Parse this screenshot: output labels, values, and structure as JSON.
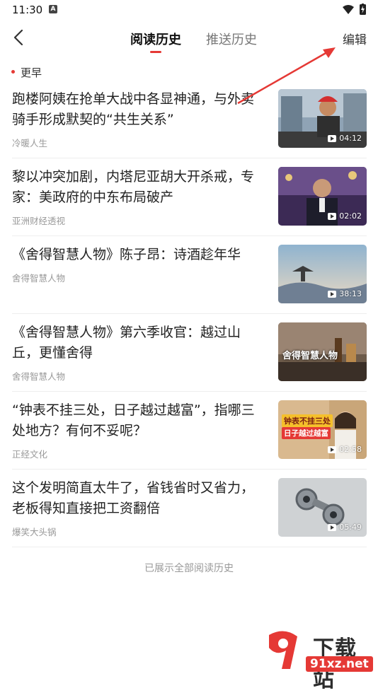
{
  "status": {
    "time": "11:30",
    "a_icon": "A"
  },
  "header": {
    "tab_active": "阅读历史",
    "tab_inactive": "推送历史",
    "edit": "编辑"
  },
  "section": "更早",
  "items": [
    {
      "title": "跑楼阿姨在抢单大战中各显神通，与外卖骑手形成默契的“共生关系”",
      "source": "冷暖人生",
      "duration": "04:12"
    },
    {
      "title": "黎以冲突加剧，内塔尼亚胡大开杀戒，专家：美政府的中东布局破产",
      "source": "亚洲财经透视",
      "duration": "02:02"
    },
    {
      "title": "《舍得智慧人物》陈子昂：诗酒趁年华",
      "source": "舍得智慧人物",
      "duration": "38:13"
    },
    {
      "title": "《舍得智慧人物》第六季收官：越过山丘，更懂舍得",
      "source": "舍得智慧人物",
      "duration": ""
    },
    {
      "title": "“钟表不挂三处，日子越过越富”，指哪三处地方？有何不妥呢？",
      "source": "正经文化",
      "duration": "02:58"
    },
    {
      "title": "这个发明简直太牛了，省钱省时又省力，老板得知直接把工资翻倍",
      "source": "爆笑大头锅",
      "duration": "05:49"
    }
  ],
  "thumb_text": {
    "t3_small": "",
    "t4_overlay": "舍得智慧人物",
    "t5_line1": "钟表不挂三处",
    "t5_line2": "日子越过越富"
  },
  "footer": "已展示全部阅读历史",
  "watermark": {
    "top": "下载站",
    "bottom": "91xz.net"
  },
  "colors": {
    "accent": "#e53935"
  }
}
